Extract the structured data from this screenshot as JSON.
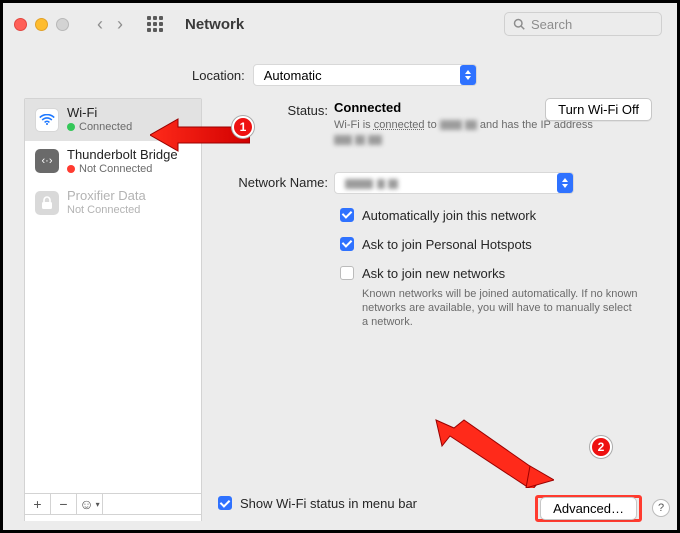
{
  "window": {
    "title": "Network"
  },
  "search": {
    "placeholder": "Search"
  },
  "location": {
    "label": "Location:",
    "value": "Automatic"
  },
  "sidebar": {
    "items": [
      {
        "title": "Wi-Fi",
        "status": "Connected",
        "dot": "green",
        "icon": "wifi"
      },
      {
        "title": "Thunderbolt Bridge",
        "status": "Not Connected",
        "dot": "red",
        "icon": "thunderbolt"
      },
      {
        "title": "Proxifier Data",
        "status": "Not Connected",
        "dot": "",
        "icon": "lock"
      }
    ],
    "toolbar": {
      "add": "+",
      "remove": "−",
      "menu": "☺︎"
    }
  },
  "panel": {
    "status_label": "Status:",
    "status_value": "Connected",
    "turn_off": "Turn Wi-Fi Off",
    "status_sub_prefix": "Wi-Fi is ",
    "status_sub_linked": "connected",
    "status_sub_mid": " to ",
    "status_sub_suffix": " and has the IP address ",
    "network_name_label": "Network Name:",
    "network_name_value": "",
    "auto_join": "Automatically join this network",
    "ask_hotspot": "Ask to join Personal Hotspots",
    "ask_new": "Ask to join new networks",
    "ask_new_hint": "Known networks will be joined automatically. If no known networks are available, you will have to manually select a network.",
    "show_status": "Show Wi-Fi status in menu bar",
    "advanced": "Advanced…",
    "help": "?"
  },
  "annotations": {
    "badge1": "1",
    "badge2": "2"
  }
}
